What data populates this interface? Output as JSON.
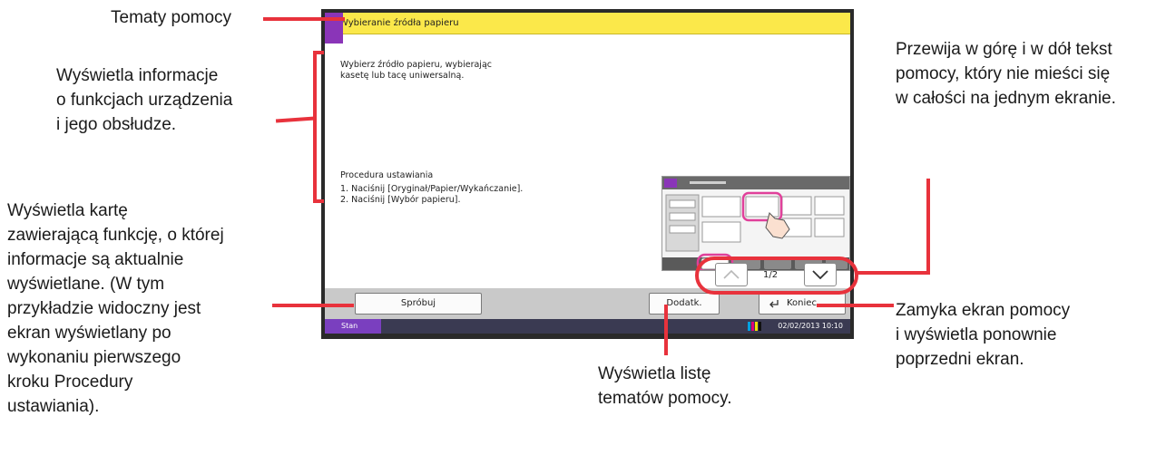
{
  "callouts": {
    "help_topics": "Tematy pomocy",
    "info": "Wyświetla informacje\no funkcjach urządzenia\ni jego obsłudze.",
    "tab_card": "Wyświetla kartę\nzawierającą funkcję, o której\ninformacje są aktualnie\nwyświetlane. (W tym\nprzykładzie widoczny jest\nekran wyświetlany po\nwykonaniu pierwszego\nkroku Procedury\nustawiania).",
    "scroll": "Przewija w górę i w dół tekst\npomocy, który nie mieści się\nw całości na jednym ekranie.",
    "close": "Zamyka ekran pomocy\ni wyświetla ponownie\npoprzedni ekran.",
    "topics_list": "Wyświetla listę\ntematów pomocy."
  },
  "screen": {
    "title": "Wybieranie źródła papieru",
    "description": "Wybierz źródło papieru, wybierając\nkasetę lub tacę uniwersalną.",
    "procedure_heading": "Procedura ustawiania",
    "procedure_steps": "1. Naciśnij [Oryginał/Papier/Wykańczanie].\n2. Naciśnij [Wybór papieru].",
    "page_indicator": "1/2",
    "buttons": {
      "try": "Spróbuj",
      "more_help": "Dodatk. pomoc",
      "close": "Koniec"
    },
    "status": {
      "label": "Stan",
      "datetime": "02/02/2013  10:10"
    }
  },
  "colors": {
    "callout_red": "#e8323c",
    "title_yellow": "#fbe84a",
    "accent_purple": "#7a3fbf"
  }
}
